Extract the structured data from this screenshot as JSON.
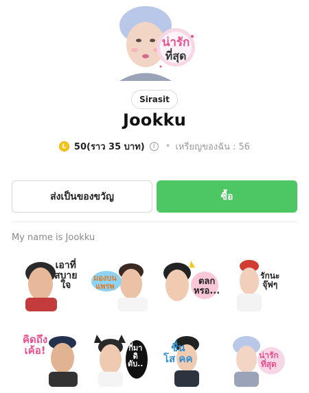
{
  "hero": {
    "caption_line1": "น่ารัก",
    "caption_line2": "ที่สุด"
  },
  "author": "Sirasit",
  "title": "Jookku",
  "price": {
    "coin_letter": "L",
    "amount": "50(ราว 35 บาท)",
    "info": "i",
    "separator": "•",
    "balance": "เหรียญของฉัน : 56"
  },
  "buttons": {
    "gift": "ส่งเป็นของขวัญ",
    "buy": "ซื้อ"
  },
  "description": "My name is Jookku",
  "stickers": [
    {
      "text": "เอาที่\nสบาย\nใจ"
    },
    {
      "text": "มองบน\nแพรพ"
    },
    {
      "text": "ตลก\nหรอ..."
    },
    {
      "text": "รักนะ\nจุ๊ฟๆ"
    },
    {
      "text": "คิดถึง\nเค้อ!"
    },
    {
      "text": "กี่มา\nดิ\nดับ.."
    },
    {
      "text": "ชื่น\nโส คค"
    },
    {
      "text": "น่ารัก\nที่สุด"
    }
  ],
  "colors": {
    "buy_green": "#4cc764",
    "coin_gold": "#f5c518",
    "pink_accent": "#e8508f"
  }
}
